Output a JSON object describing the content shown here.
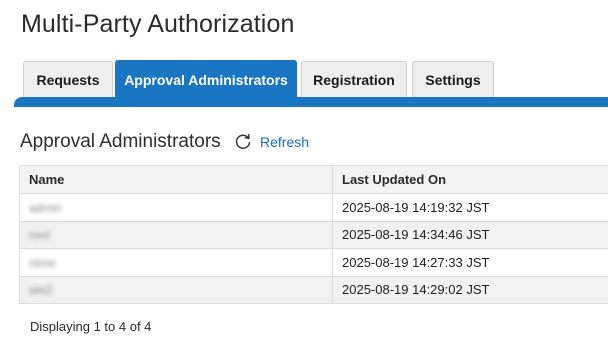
{
  "page": {
    "title": "Multi-Party Authorization"
  },
  "tabs": [
    {
      "label": "Requests",
      "active": false
    },
    {
      "label": "Approval Administrators",
      "active": true
    },
    {
      "label": "Registration",
      "active": false
    },
    {
      "label": "Settings",
      "active": false
    }
  ],
  "section": {
    "title": "Approval Administrators",
    "refresh_label": "Refresh",
    "refresh_icon": "refresh-icon"
  },
  "table": {
    "columns": [
      "Name",
      "Last Updated On"
    ],
    "rows": [
      {
        "name": "admin",
        "updated": "2025-08-19 14:19:32 JST"
      },
      {
        "name": "root",
        "updated": "2025-08-19 14:34:46 JST"
      },
      {
        "name": "ntme",
        "updated": "2025-08-19 14:27:33 JST"
      },
      {
        "name": "ate2",
        "updated": "2025-08-19 14:29:02 JST"
      }
    ]
  },
  "footer": {
    "status": "Displaying 1 to 4 of 4"
  },
  "colors": {
    "accent": "#1a76c2",
    "link": "#1a6fb5",
    "header_bg": "#f2f2f2",
    "stripe": "#f1f1f1"
  }
}
